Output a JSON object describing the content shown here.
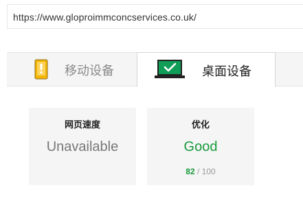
{
  "url_bar": {
    "url": "https://www.gloproimmconcservices.co.uk/"
  },
  "tabs": [
    {
      "label": "移动设备",
      "icon": "mobile-warning-icon",
      "selected": false
    },
    {
      "label": "桌面设备",
      "icon": "desktop-check-icon",
      "selected": true
    }
  ],
  "cards": {
    "speed": {
      "title": "网页速度",
      "value": "Unavailable"
    },
    "optimization": {
      "title": "优化",
      "value": "Good",
      "score": "82",
      "score_separator": " / ",
      "score_max": "100"
    }
  },
  "colors": {
    "good": "#199a3b",
    "warning_icon": "#f4b400",
    "check_icon": "#0f9d58",
    "card_background": "#f5f5f5"
  }
}
